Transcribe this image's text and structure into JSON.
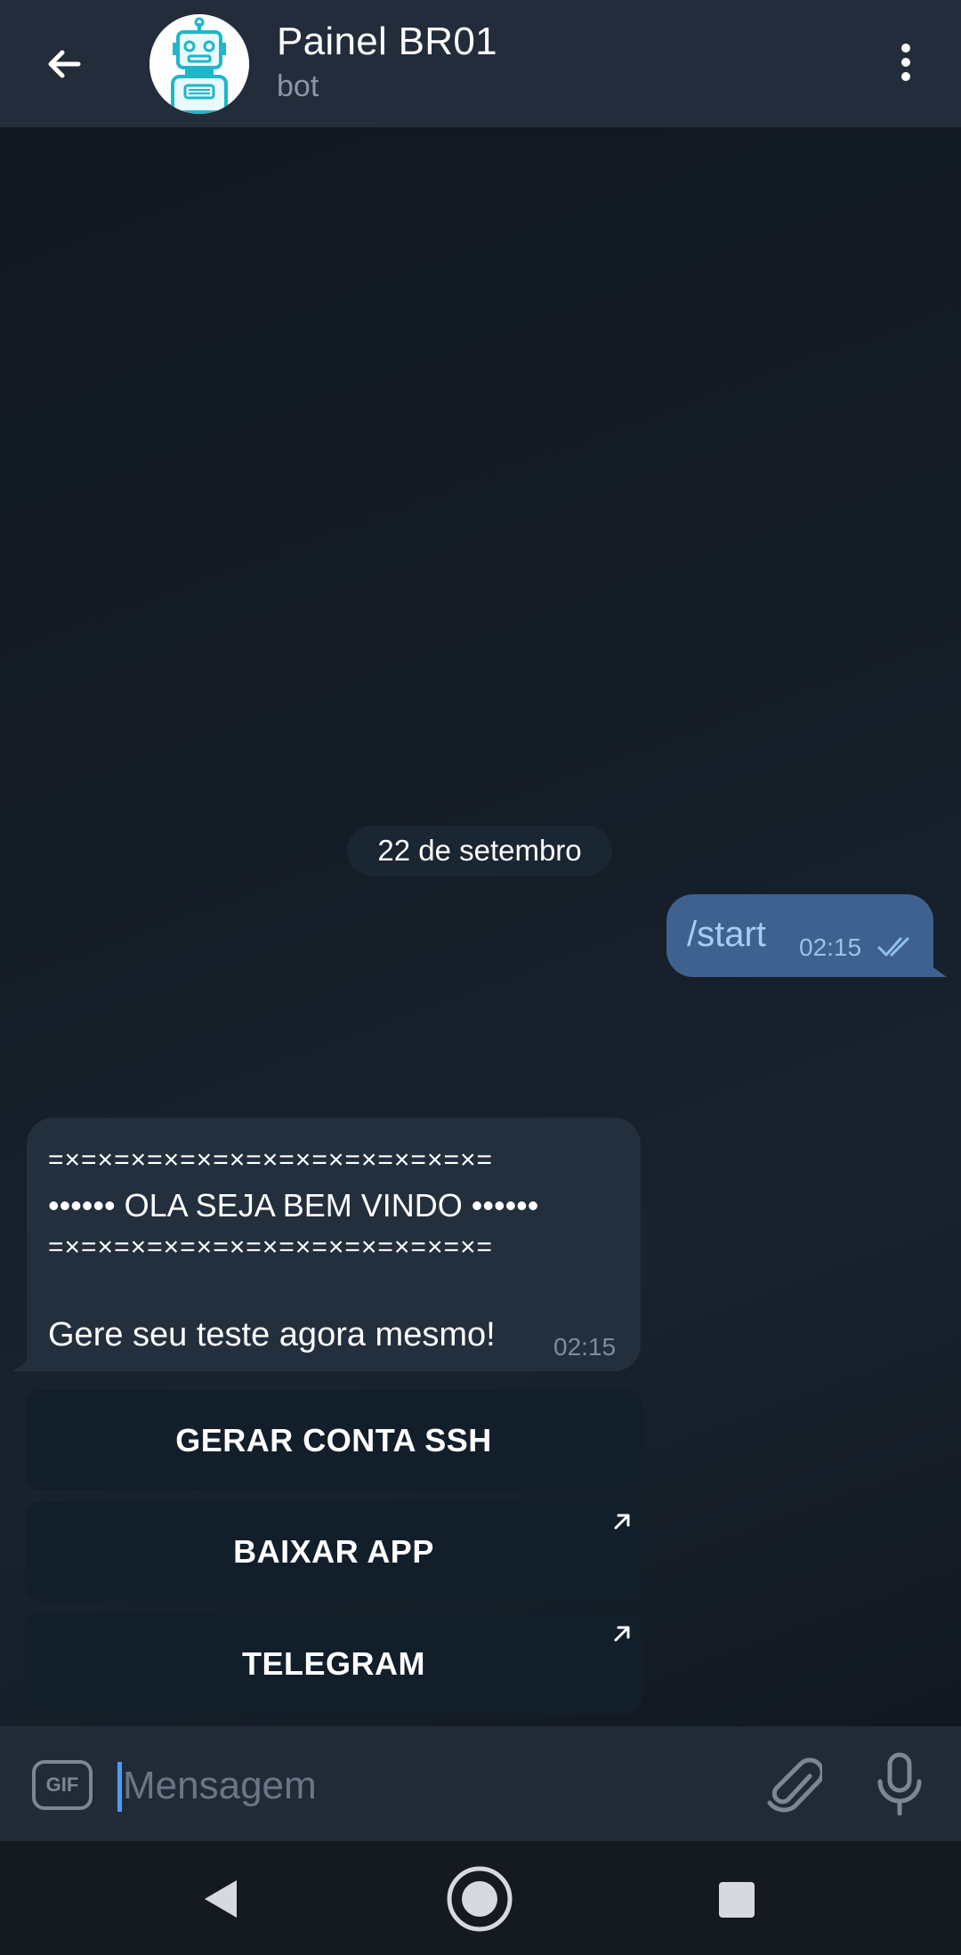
{
  "header": {
    "title": "Painel BR01",
    "subtitle": "bot",
    "back_icon": "arrow-left-icon",
    "menu_icon": "more-vertical-icon",
    "avatar_icon": "robot-icon"
  },
  "chat": {
    "date_separator": "22 de setembro",
    "outgoing": {
      "text": "/start",
      "time": "02:15",
      "status_icon": "double-check-icon"
    },
    "incoming": {
      "line1": "=×=×=×=×=×=×=×=×=×=×=×=×=×=",
      "line2": "•••••• OLA SEJA BEM VINDO ••••••",
      "line3": "=×=×=×=×=×=×=×=×=×=×=×=×=×=",
      "line4": "Gere seu teste agora mesmo!",
      "time": "02:15"
    },
    "keyboard": [
      {
        "label": "GERAR CONTA SSH",
        "external": false
      },
      {
        "label": "BAIXAR APP",
        "external": true
      },
      {
        "label": "TELEGRAM",
        "external": true
      }
    ]
  },
  "input": {
    "gif_label": "GIF",
    "placeholder": "Mensagem",
    "value": ""
  },
  "colors": {
    "header_bg": "#222c3a",
    "outgoing_bubble": "#3e6190",
    "incoming_bubble": "#232f3c",
    "accent": "#4b9cf1"
  }
}
